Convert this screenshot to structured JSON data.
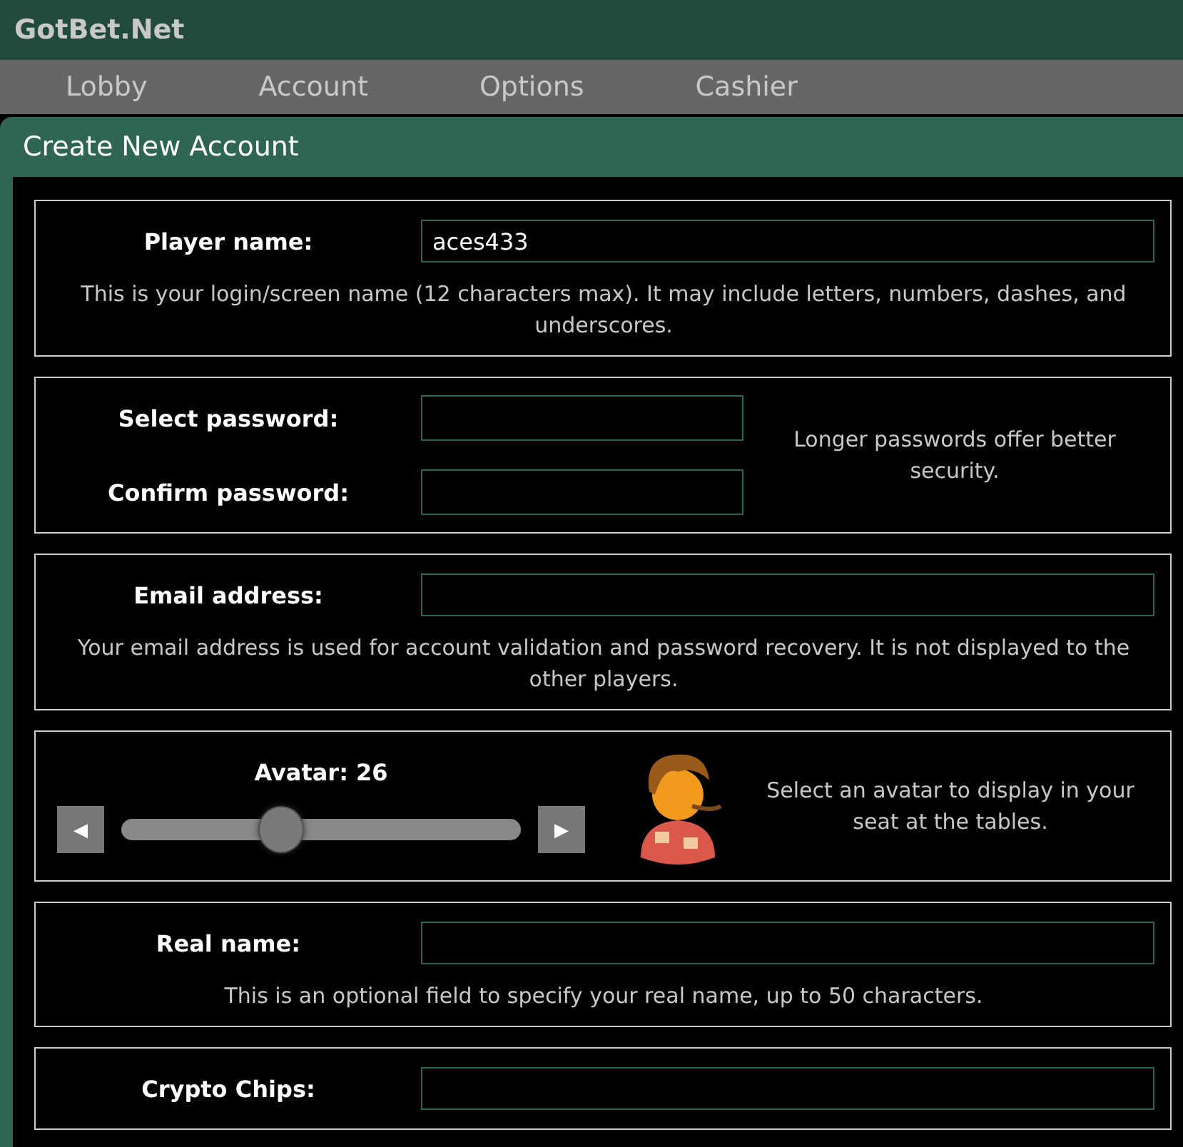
{
  "app": {
    "title": "GotBet.Net"
  },
  "menu": [
    {
      "label": "Lobby"
    },
    {
      "label": "Account"
    },
    {
      "label": "Options"
    },
    {
      "label": "Cashier"
    }
  ],
  "panel": {
    "title": "Create New Account"
  },
  "sections": [
    {
      "kind": "field",
      "label": "Player name:",
      "value": "aces433",
      "hint": "This is your login/screen name (12 characters max). It may include letters, numbers, dashes, and underscores."
    },
    {
      "kind": "passwords",
      "fields": [
        {
          "label": "Select password:"
        },
        {
          "label": "Confirm password:"
        }
      ],
      "note": "Longer passwords offer better security."
    },
    {
      "kind": "field",
      "label": "Email address:",
      "hint": "Your email address is used for account validation and password recovery. It is not displayed to the other players."
    },
    {
      "kind": "avatar",
      "label": "Avatar: 26",
      "prev": "◀",
      "next": "▶",
      "level": 0.4,
      "note": "Select an avatar to display in your seat at the tables."
    },
    {
      "kind": "field",
      "label": "Real name:",
      "hint": "This is an optional field to specify your real name, up to 50 characters."
    },
    {
      "kind": "field",
      "label": "Crypto Chips:"
    }
  ]
}
